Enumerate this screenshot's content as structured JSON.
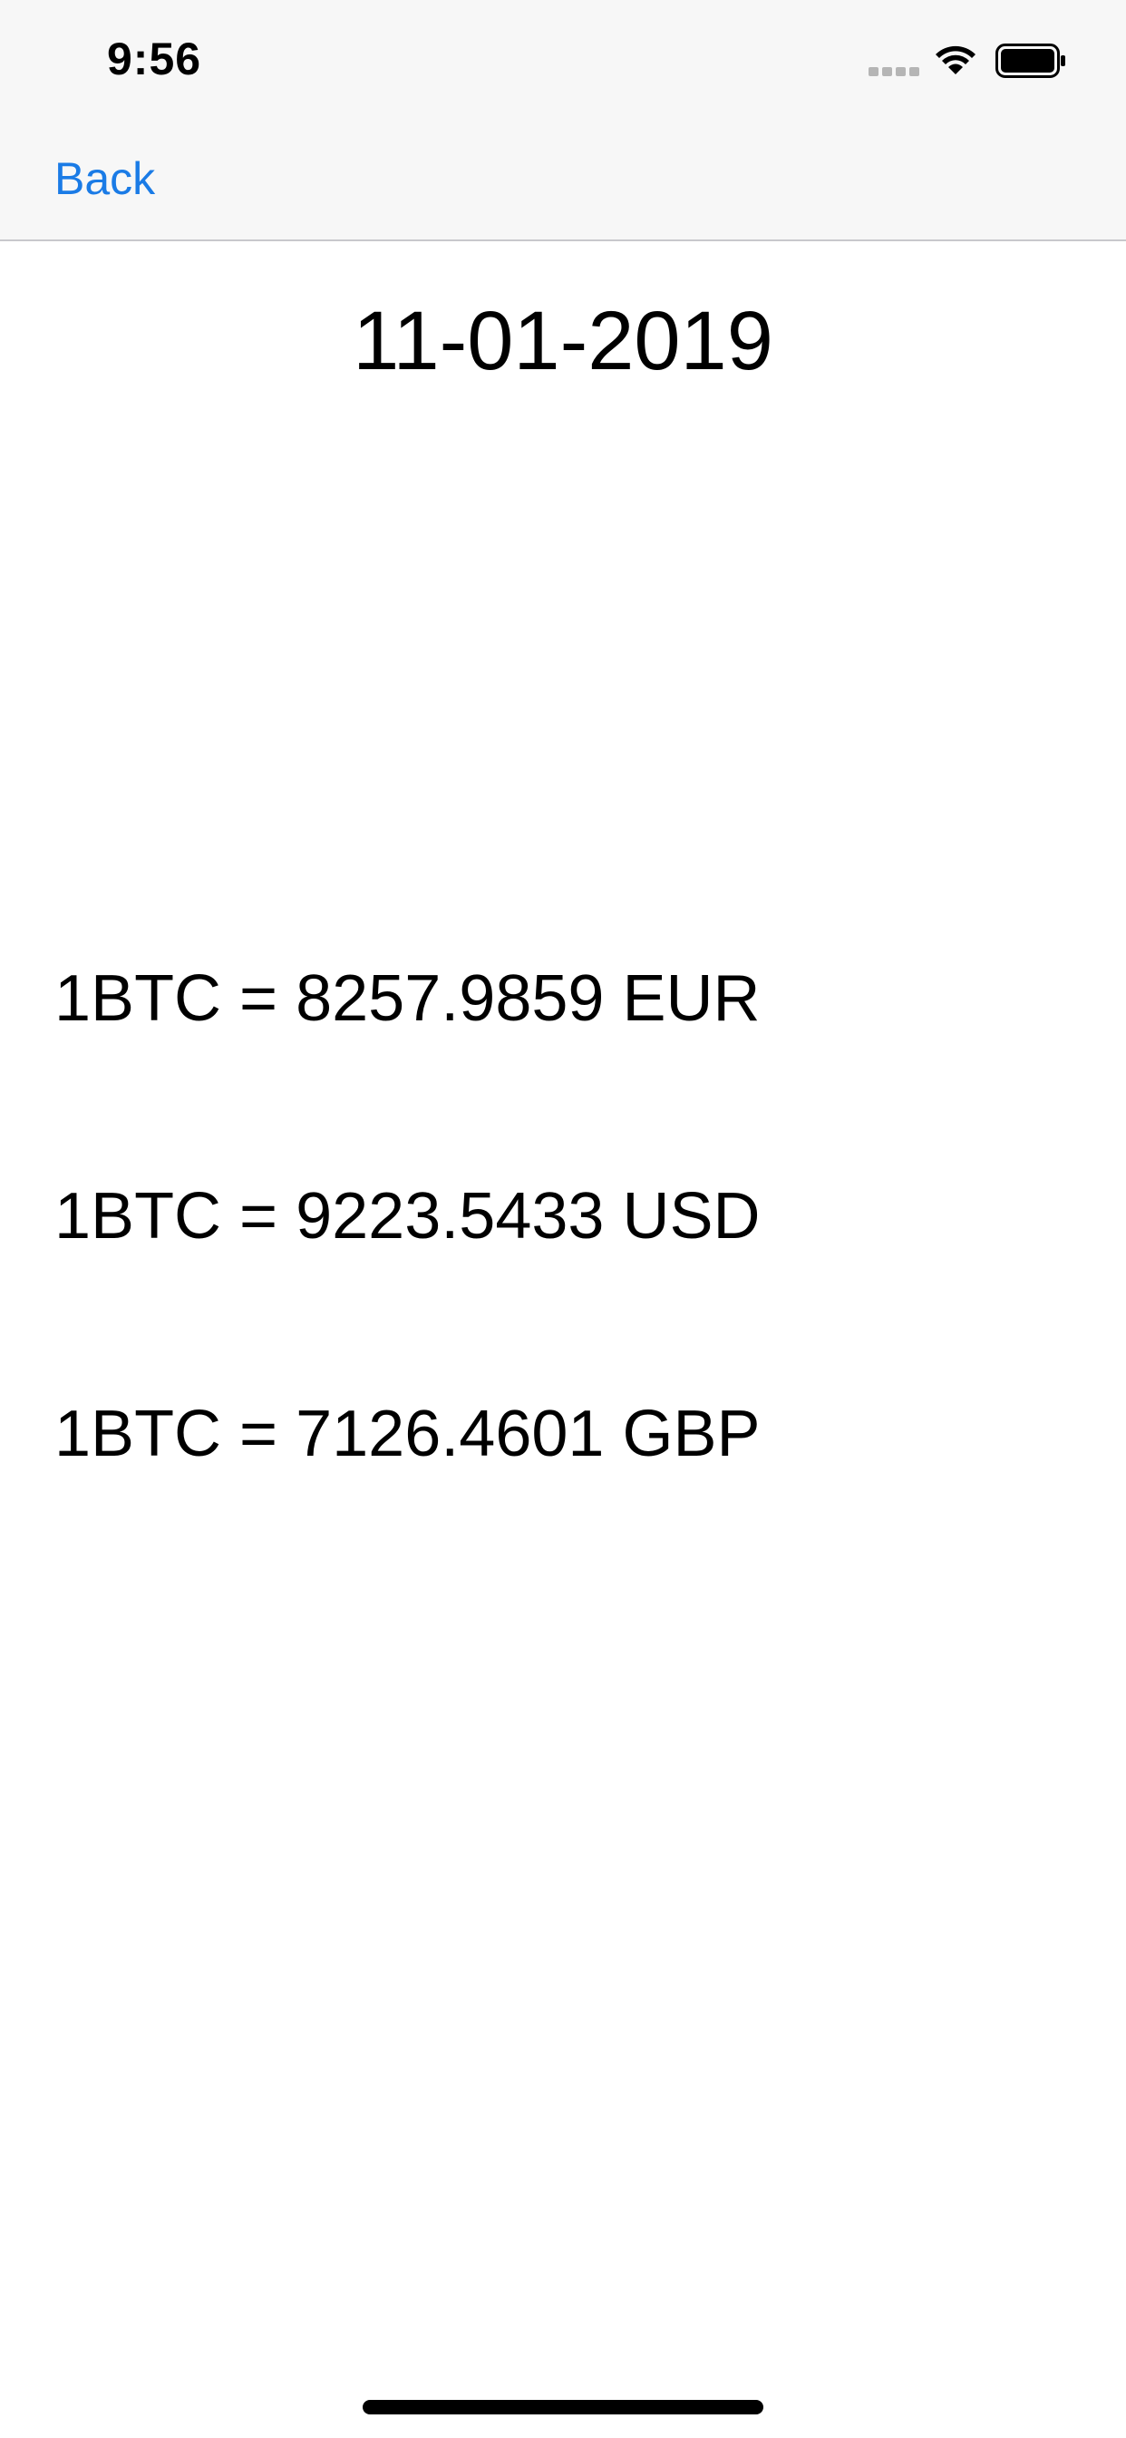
{
  "status_bar": {
    "time": "9:56",
    "signal_icon": "cellular-signal-icon",
    "wifi_icon": "wifi-icon",
    "battery_icon": "battery-icon"
  },
  "nav": {
    "back_label": "Back",
    "back_color": "#1a7be6"
  },
  "date": "11-01-2019",
  "rates": [
    {
      "text": "1BTC = 8257.9859 EUR"
    },
    {
      "text": "1BTC = 9223.5433 USD"
    },
    {
      "text": "1BTC = 7126.4601 GBP"
    }
  ]
}
